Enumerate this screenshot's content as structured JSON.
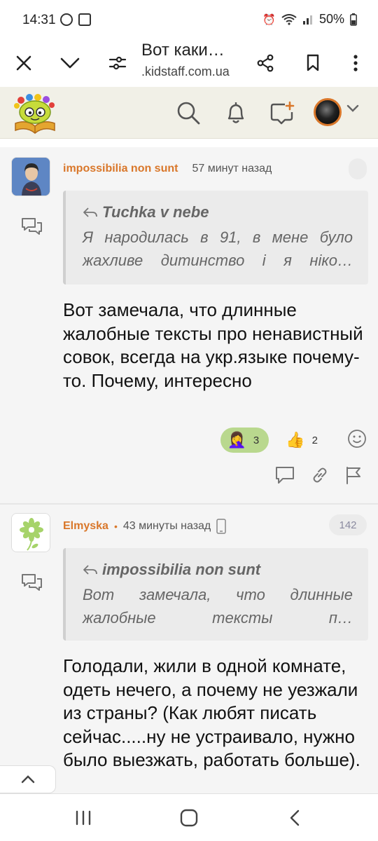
{
  "status_bar": {
    "time": "14:31",
    "battery": "50%"
  },
  "browser": {
    "page_title": "Вот каки…",
    "url": ".kidstaff.com.ua"
  },
  "header": {
    "logo": "kidstaff-logo",
    "icons": [
      "search-icon",
      "bell-icon",
      "new-message-icon"
    ],
    "accent": "#d9772a"
  },
  "posts": [
    {
      "author": "impossibilia non sunt",
      "time": "57 минут назад",
      "quote": {
        "author": "Tuchka v nebe",
        "text": "Я народилась в 91, в мене було жахливе дитинство і я ніко…"
      },
      "body": "Вот замечала, что длинные жалобные тексты про ненавистный совок, всегда на укр.языке почему-то. Почему, интересно",
      "reactions": [
        {
          "emoji": "🤦‍♀️",
          "count": "3",
          "active": true
        },
        {
          "emoji": "👍",
          "count": "2",
          "active": false
        }
      ]
    },
    {
      "author": "Elmyska",
      "separator": "•",
      "time": "43 минуты назад",
      "post_number": "142",
      "quote": {
        "author": "impossibilia non sunt",
        "text": "Вот замечала, что длинные жалобные тексты п…"
      },
      "body": "Голодали, жили в одной комнате, одеть нечего, а почему не уезжали из страны? (Как любят писать сейчас.....ну не устраивало, нужно было выезжать, работать больше)."
    }
  ]
}
